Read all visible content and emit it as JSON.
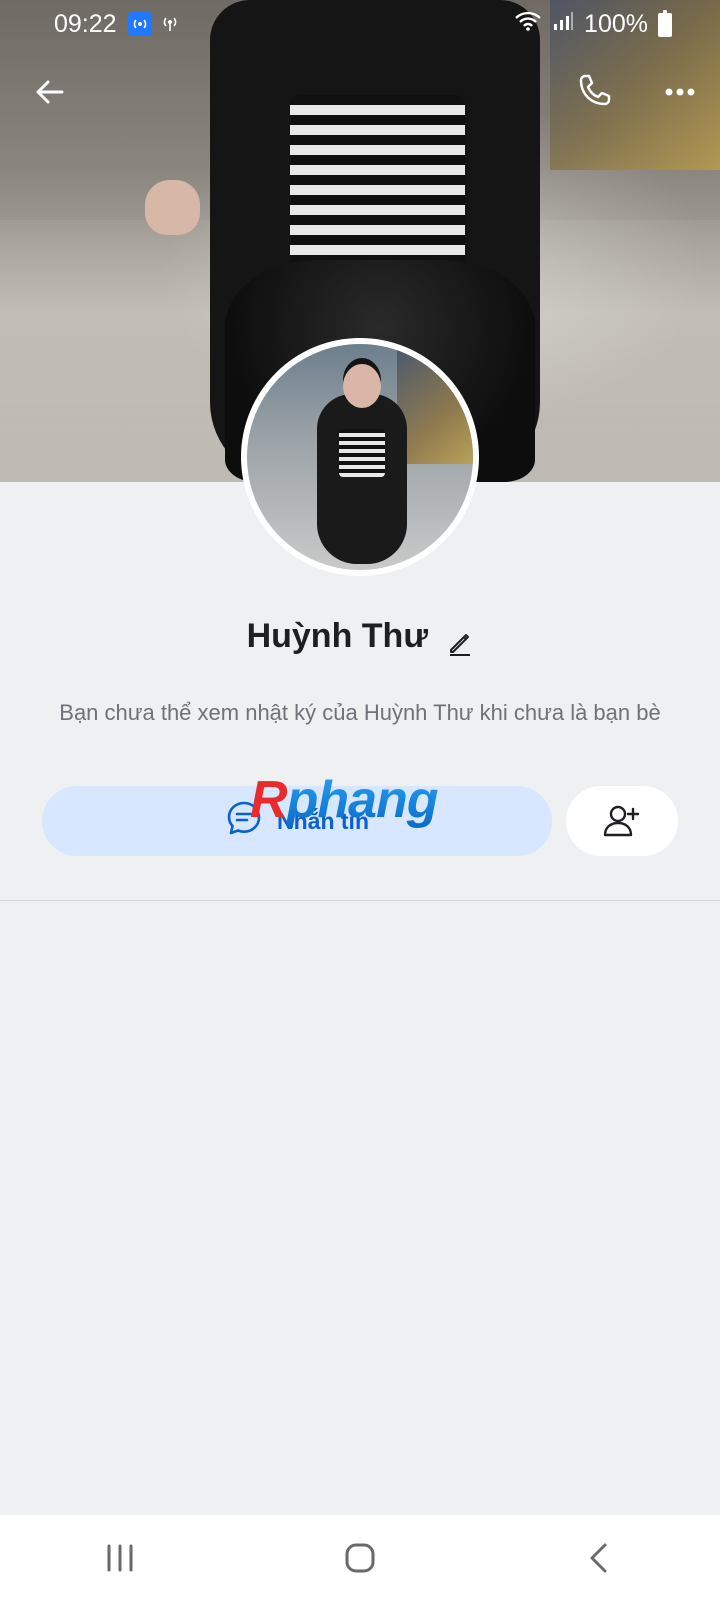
{
  "status_bar": {
    "time": "09:22",
    "battery": "100%",
    "left_icons": [
      "hotspot-icon",
      "signal-broadcast-icon"
    ],
    "right_icons": [
      "wifi-icon",
      "cell-signal-icon",
      "battery-icon"
    ]
  },
  "header": {
    "back_icon": "arrow-left-icon",
    "call_icon": "phone-icon",
    "more_icon": "more-horizontal-icon"
  },
  "profile": {
    "name": "Huỳnh Thư",
    "edit_icon": "pencil-icon",
    "notice": "Bạn chưa thể xem nhật ký của Huỳnh Thư khi chưa là bạn bè"
  },
  "actions": {
    "message_label": "Nhắn tin",
    "message_icon": "chat-bubble-icon",
    "add_friend_icon": "add-user-icon"
  },
  "watermark": {
    "text_first": "R",
    "text_rest": "phang"
  },
  "nav": {
    "items": [
      "recent-apps-icon",
      "home-icon",
      "back-icon"
    ]
  },
  "colors": {
    "accent": "#0b5fd0",
    "message_button_bg": "#d6e7ff",
    "page_bg": "#eef0f2"
  }
}
